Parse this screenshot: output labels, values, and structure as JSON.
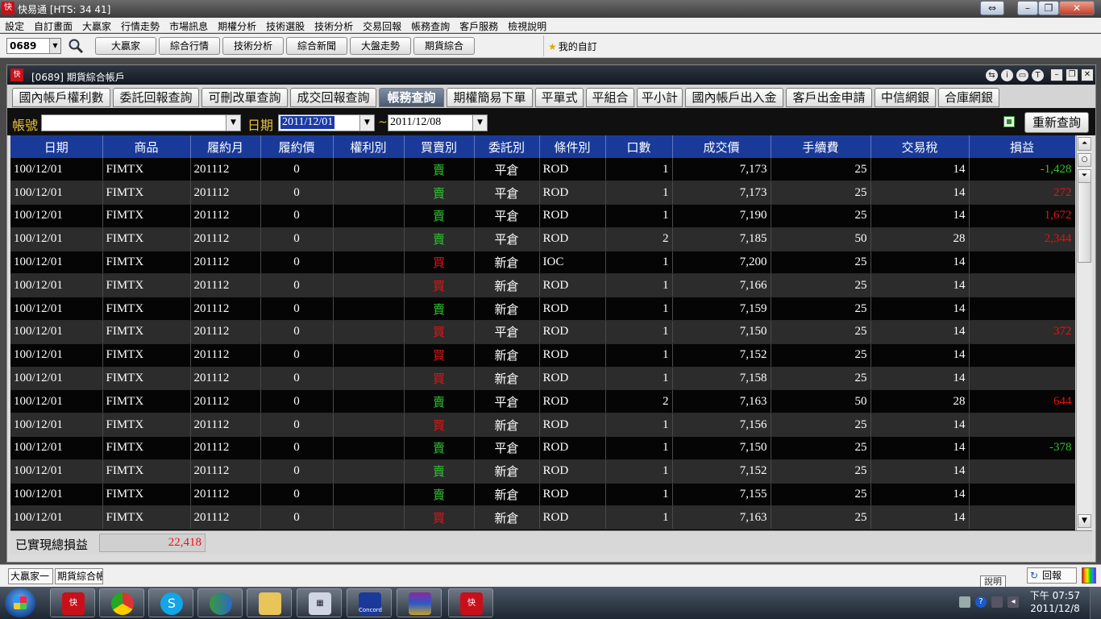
{
  "app": {
    "title": "快易通 [HTS: 34 41]",
    "icon_text": "快"
  },
  "menu": [
    "設定",
    "自訂畫面",
    "大贏家",
    "行情走勢",
    "市場訊息",
    "期權分析",
    "技術選股",
    "技術分析",
    "交易回報",
    "帳務查詢",
    "客戶服務",
    "檢視說明"
  ],
  "toolbar": {
    "stock_code": "0689",
    "buttons": [
      "大贏家",
      "綜合行情",
      "技術分析",
      "綜合新聞",
      "大盤走勢",
      "期貨綜合"
    ],
    "favorites_label": "我的自訂"
  },
  "window": {
    "title": "[0689] 期貨綜合帳戶",
    "icon_text": "快"
  },
  "tabs": [
    "國內帳戶權利數",
    "委託回報查詢",
    "可刪改單查詢",
    "成交回報查詢",
    "帳務查詢",
    "期權簡易下單",
    "平單式",
    "平組合",
    "平小計",
    "國內帳戶出入金",
    "客戶出金申請",
    "中信網銀",
    "合庫網銀"
  ],
  "active_tab": "帳務查詢",
  "filter": {
    "account_label": "帳號",
    "account_value": "",
    "date_label": "日期",
    "date_from": "2011/12/01",
    "date_sep": "~",
    "date_to": "2011/12/08",
    "requery_label": "重新查詢"
  },
  "table": {
    "headers": [
      "日期",
      "商品",
      "履約月",
      "履約價",
      "權利別",
      "買賣別",
      "委託別",
      "條件別",
      "口數",
      "成交價",
      "手續費",
      "交易稅",
      "損益"
    ],
    "rows": [
      [
        "100/12/01",
        "FIMTX",
        "201112",
        "0",
        "",
        "賣",
        "平倉",
        "ROD",
        "1",
        "7,173",
        "25",
        "14",
        "-1,428"
      ],
      [
        "100/12/01",
        "FIMTX",
        "201112",
        "0",
        "",
        "賣",
        "平倉",
        "ROD",
        "1",
        "7,173",
        "25",
        "14",
        "272"
      ],
      [
        "100/12/01",
        "FIMTX",
        "201112",
        "0",
        "",
        "賣",
        "平倉",
        "ROD",
        "1",
        "7,190",
        "25",
        "14",
        "1,672"
      ],
      [
        "100/12/01",
        "FIMTX",
        "201112",
        "0",
        "",
        "賣",
        "平倉",
        "ROD",
        "2",
        "7,185",
        "50",
        "28",
        "2,344"
      ],
      [
        "100/12/01",
        "FIMTX",
        "201112",
        "0",
        "",
        "買",
        "新倉",
        "IOC",
        "1",
        "7,200",
        "25",
        "14",
        ""
      ],
      [
        "100/12/01",
        "FIMTX",
        "201112",
        "0",
        "",
        "買",
        "新倉",
        "ROD",
        "1",
        "7,166",
        "25",
        "14",
        ""
      ],
      [
        "100/12/01",
        "FIMTX",
        "201112",
        "0",
        "",
        "賣",
        "新倉",
        "ROD",
        "1",
        "7,159",
        "25",
        "14",
        ""
      ],
      [
        "100/12/01",
        "FIMTX",
        "201112",
        "0",
        "",
        "買",
        "平倉",
        "ROD",
        "1",
        "7,150",
        "25",
        "14",
        "372"
      ],
      [
        "100/12/01",
        "FIMTX",
        "201112",
        "0",
        "",
        "買",
        "新倉",
        "ROD",
        "1",
        "7,152",
        "25",
        "14",
        ""
      ],
      [
        "100/12/01",
        "FIMTX",
        "201112",
        "0",
        "",
        "買",
        "新倉",
        "ROD",
        "1",
        "7,158",
        "25",
        "14",
        ""
      ],
      [
        "100/12/01",
        "FIMTX",
        "201112",
        "0",
        "",
        "賣",
        "平倉",
        "ROD",
        "2",
        "7,163",
        "50",
        "28",
        "644"
      ],
      [
        "100/12/01",
        "FIMTX",
        "201112",
        "0",
        "",
        "買",
        "新倉",
        "ROD",
        "1",
        "7,156",
        "25",
        "14",
        ""
      ],
      [
        "100/12/01",
        "FIMTX",
        "201112",
        "0",
        "",
        "賣",
        "平倉",
        "ROD",
        "1",
        "7,150",
        "25",
        "14",
        "-378"
      ],
      [
        "100/12/01",
        "FIMTX",
        "201112",
        "0",
        "",
        "賣",
        "新倉",
        "ROD",
        "1",
        "7,152",
        "25",
        "14",
        ""
      ],
      [
        "100/12/01",
        "FIMTX",
        "201112",
        "0",
        "",
        "賣",
        "新倉",
        "ROD",
        "1",
        "7,155",
        "25",
        "14",
        ""
      ],
      [
        "100/12/01",
        "FIMTX",
        "201112",
        "0",
        "",
        "買",
        "新倉",
        "ROD",
        "1",
        "7,163",
        "25",
        "14",
        ""
      ]
    ]
  },
  "summary": {
    "label": "已實現總損益",
    "value": "22,418"
  },
  "app_tasks": [
    "大贏家一",
    "期貨綜合帳戶"
  ],
  "help_tooltip": "說明",
  "back_label": "回報",
  "clock": {
    "time": "下午 07:57",
    "date": "2011/12/8"
  },
  "taskbar_apps": [
    "app-icon",
    "chrome-icon",
    "skype-icon",
    "messenger-icon",
    "explorer-icon",
    "calculator-icon",
    "concord-icon",
    "winrar-icon",
    "app-icon"
  ],
  "taskbar_labels": {
    "concord": "Concord"
  },
  "colors": {
    "header_blue": "#1a3a9a",
    "buy_red": "#e81212",
    "sell_green": "#2ec42e",
    "label_gold": "#e8c23a",
    "active_tab": "#4a5a70"
  }
}
